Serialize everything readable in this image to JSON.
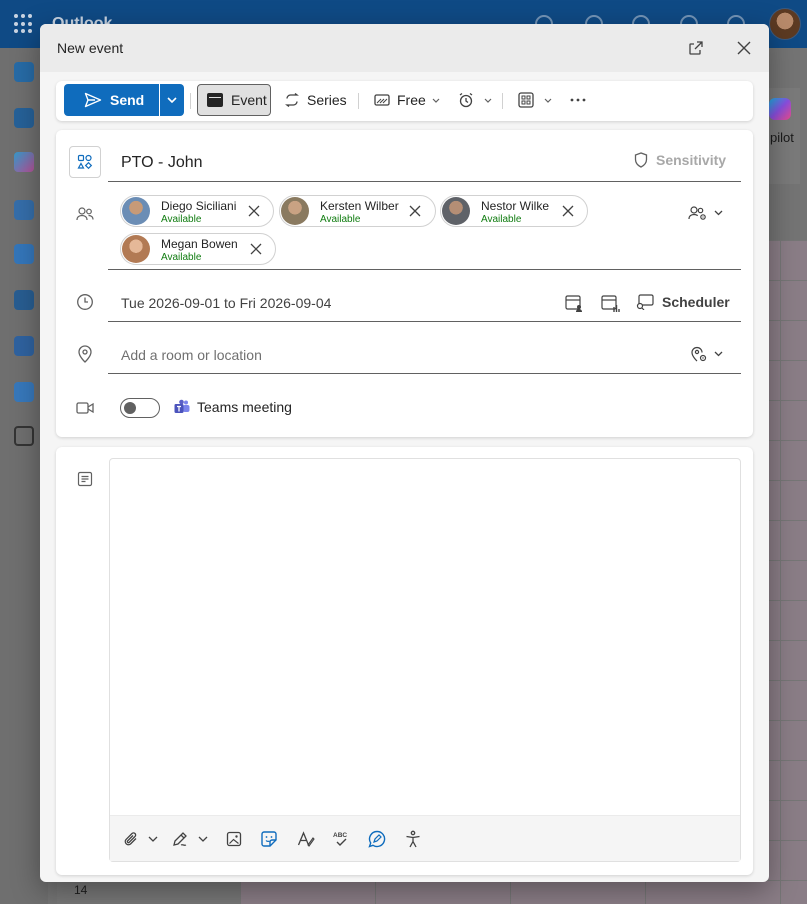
{
  "app": {
    "name": "Outlook",
    "copilot_label": "pilot",
    "hour_label": "14"
  },
  "dialog": {
    "title": "New event"
  },
  "toolbar": {
    "send_label": "Send",
    "event_label": "Event",
    "series_label": "Series",
    "free_label": "Free"
  },
  "event": {
    "title": "PTO - John",
    "sensitivity_label": "Sensitivity",
    "attendees": [
      {
        "name": "Diego Siciliani",
        "status": "Available",
        "avatar_color": "#6b8db5"
      },
      {
        "name": "Kersten Wilber",
        "status": "Available",
        "avatar_color": "#8a7a60"
      },
      {
        "name": "Nestor Wilke",
        "status": "Available",
        "avatar_color": "#5f6268"
      },
      {
        "name": "Megan Bowen",
        "status": "Available",
        "avatar_color": "#b27a54"
      }
    ],
    "date_range": "Tue 2026-09-01 to Fri 2026-09-04",
    "scheduler_label": "Scheduler",
    "location_placeholder": "Add a room or location",
    "teams_label": "Teams meeting"
  },
  "colors": {
    "accent": "#0f6cbd",
    "available": "#107c10",
    "teams": "#5b5fc7"
  }
}
